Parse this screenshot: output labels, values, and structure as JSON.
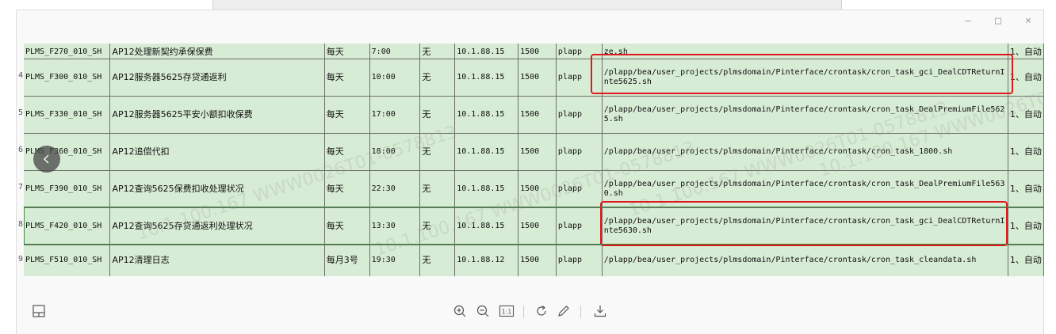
{
  "window": {
    "minimize_glyph": "–",
    "maximize_glyph": "□",
    "close_glyph": "×"
  },
  "table": {
    "partial_row": {
      "cells": [
        "PLMS_F270_010_SH",
        "AP12处理新契约承保保费",
        "每天",
        "7:00",
        "无",
        "10.1.88.15",
        "1500",
        "plapp",
        "ze.sh",
        "1、自动"
      ]
    },
    "rows": [
      {
        "rownum": "4",
        "cells": [
          "PLMS_F300_010_SH",
          "AP12服务器5625存贷通返利",
          "每天",
          "10:00",
          "无",
          "10.1.88.15",
          "1500",
          "plapp",
          "/plapp/bea/user_projects/plmsdomain/Pinterface/crontask/cron_task_gci_DealCDTReturnInte5625.sh",
          "1、自动"
        ]
      },
      {
        "rownum": "5",
        "cells": [
          "PLMS_F330_010_SH",
          "AP12服务器5625平安小额扣收保费",
          "每天",
          "17:00",
          "无",
          "10.1.88.15",
          "1500",
          "plapp",
          "/plapp/bea/user_projects/plmsdomain/Pinterface/crontask/cron_task_DealPremiumFile5625.sh",
          "1、自动"
        ]
      },
      {
        "rownum": "6",
        "cells": [
          "PLMS_F360_010_SH",
          "AP12追偿代扣",
          "每天",
          "18:00",
          "无",
          "10.1.88.15",
          "1500",
          "plapp",
          "/plapp/bea/user_projects/plmsdomain/Pinterface/crontask/cron_task_1800.sh",
          "1、自动"
        ]
      },
      {
        "rownum": "7",
        "cells": [
          "PLMS_F390_010_SH",
          "AP12查询5625保费扣收处理状况",
          "每天",
          "22:30",
          "无",
          "10.1.88.15",
          "1500",
          "plapp",
          "/plapp/bea/user_projects/plmsdomain/Pinterface/crontask/cron_task_DealPremiumFile5630.sh",
          "1、自动"
        ]
      },
      {
        "rownum": "8",
        "cells": [
          "PLMS_F420_010_SH",
          "AP12查询5625存贷通返利处理状况",
          "每天",
          "13:30",
          "无",
          "10.1.88.15",
          "1500",
          "plapp",
          "/plapp/bea/user_projects/plmsdomain/Pinterface/crontask/cron_task_gci_DealCDTReturnInte5630.sh",
          "1、自动"
        ]
      },
      {
        "rownum": "9",
        "cells": [
          "PLMS_F510_010_SH",
          "AP12清理日志",
          "每月3号",
          "19:30",
          "无",
          "10.1.88.12",
          "1500",
          "plapp",
          "/plapp/bea/user_projects/plmsdomain/Pinterface/crontask/cron_task_cleandata.sh",
          "1、自动"
        ]
      }
    ]
  },
  "watermark": {
    "text": "10.1.100.167 WWW0026T01-0578813"
  },
  "toolbar": {
    "icons": [
      "thumbnail-panel-icon",
      "zoom-in-icon",
      "zoom-out-icon",
      "actual-size-icon",
      "rotate-icon",
      "edit-icon",
      "download-icon"
    ],
    "actual_size_label": "1:1"
  },
  "colors": {
    "cell_green": "#d7ecd4",
    "highlight_red": "#e0191d",
    "selection_green": "#3c8c3c"
  }
}
